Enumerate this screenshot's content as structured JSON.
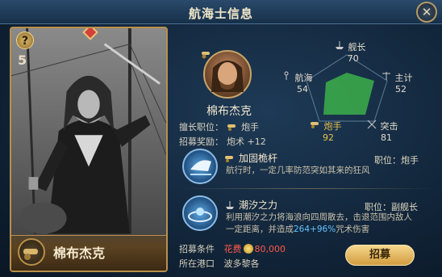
{
  "window": {
    "title": "航海士信息"
  },
  "card": {
    "question": "?",
    "stars": "5",
    "name": "棉布杰克",
    "icon": "cannon-icon"
  },
  "hero": {
    "name": "棉布杰克",
    "specialty_label": "擅长职位：",
    "specialty_value": "炮手",
    "recruit_bonus_label": "招募奖励：",
    "recruit_bonus_value": "炮术 +12"
  },
  "stats": {
    "captain": {
      "name": "舰长",
      "value": "70",
      "icon": "ship-icon"
    },
    "navigation": {
      "name": "航海",
      "value": "54",
      "icon": "anchor-icon"
    },
    "accounting": {
      "name": "主计",
      "value": "52",
      "icon": "scale-icon"
    },
    "gunner": {
      "name": "炮手",
      "value": "92",
      "icon": "cannon-icon"
    },
    "assault": {
      "name": "突击",
      "value": "81",
      "icon": "swords-icon"
    },
    "fill_color": "#3aa84a",
    "highlight_color": "#e8c24d"
  },
  "skills": [
    {
      "name": "加固桅杆",
      "position": "职位：炮手",
      "description": "航行时，一定几率防范突如其来的狂风",
      "icon": "mast-icon"
    },
    {
      "name": "潮汐之力",
      "position": "职位：副舰长",
      "description_line1": "利用潮汐之力将海浪向四周散去，击退范围内敌人",
      "description_line2_prefix": "一定距离，并造成",
      "description_line2_highlight": "264+96%",
      "description_line2_suffix": "咒术伤害",
      "icon": "wave-icon"
    }
  ],
  "recruit": {
    "condition_label": "招募条件",
    "condition_value_prefix": "花费",
    "condition_value_amount": "80,000",
    "port_label": "所在港口",
    "port_value": "波多黎各",
    "button_label": "招募"
  }
}
